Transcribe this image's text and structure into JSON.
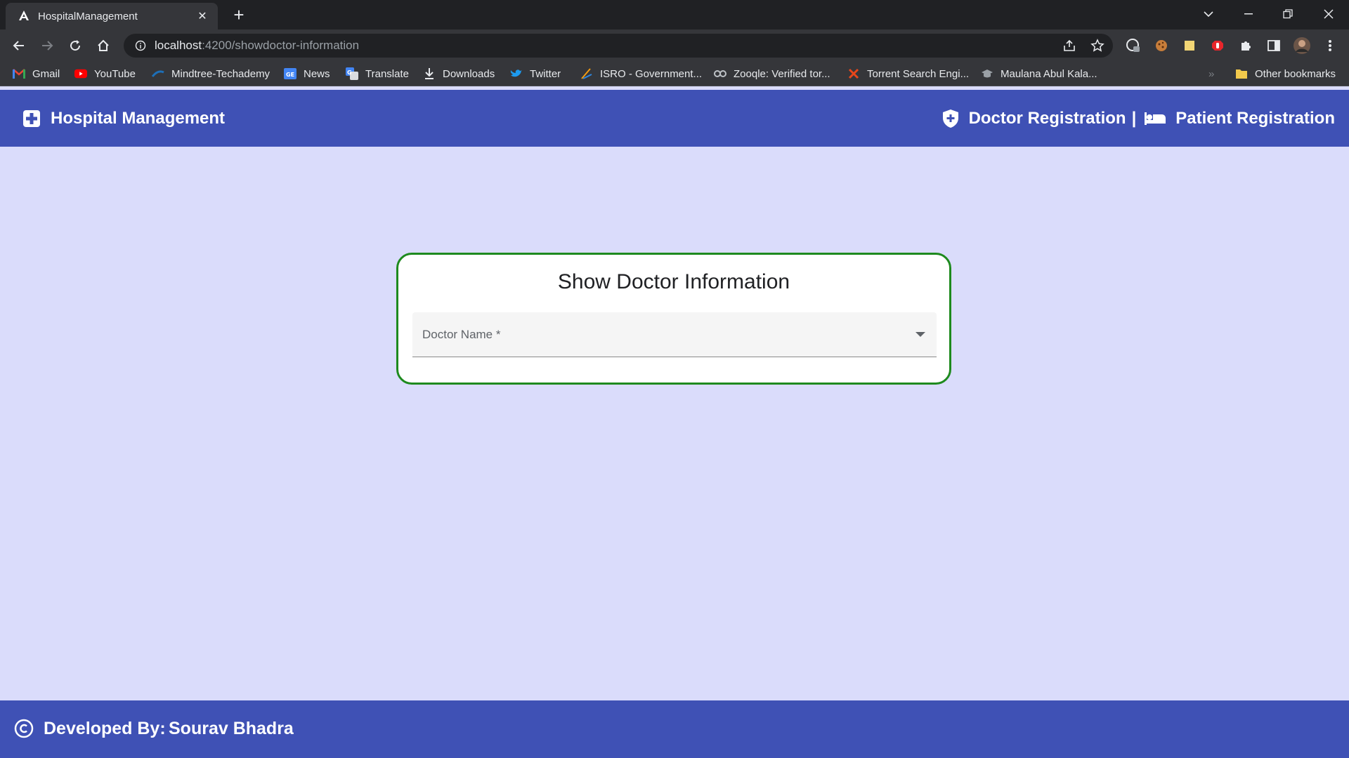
{
  "browser": {
    "tab_title": "HospitalManagement",
    "tab_favicon": "angular-icon",
    "url_host": "localhost",
    "url_path": ":4200/showdoctor-information",
    "bookmarks": [
      {
        "label": "Gmail",
        "icon": "gmail-icon"
      },
      {
        "label": "YouTube",
        "icon": "youtube-icon"
      },
      {
        "label": "Mindtree-Techademy",
        "icon": "mindtree-icon"
      },
      {
        "label": "News",
        "icon": "news-icon"
      },
      {
        "label": "Translate",
        "icon": "translate-icon"
      },
      {
        "label": "Downloads",
        "icon": "download-icon"
      },
      {
        "label": "Twitter",
        "icon": "twitter-icon"
      },
      {
        "label": "ISRO - Government...",
        "icon": "isro-icon"
      },
      {
        "label": "Zooqle: Verified tor...",
        "icon": "zooqle-icon"
      },
      {
        "label": "Torrent Search Engi...",
        "icon": "torrent-icon"
      },
      {
        "label": "Maulana Abul Kala...",
        "icon": "graduation-cap-icon"
      }
    ],
    "other_bookmarks": "Other bookmarks"
  },
  "app": {
    "brand": "Hospital Management",
    "nav_doctor": "Doctor Registration",
    "nav_separator": "|",
    "nav_patient": "Patient Registration",
    "card_title": "Show Doctor Information",
    "select_label": "Doctor Name *",
    "footer_label": "Developed By:",
    "footer_name": "Sourav Bhadra"
  },
  "colors": {
    "primary": "#3f51b5",
    "page_background": "#dadcfb",
    "card_border": "#1e8a1e"
  }
}
